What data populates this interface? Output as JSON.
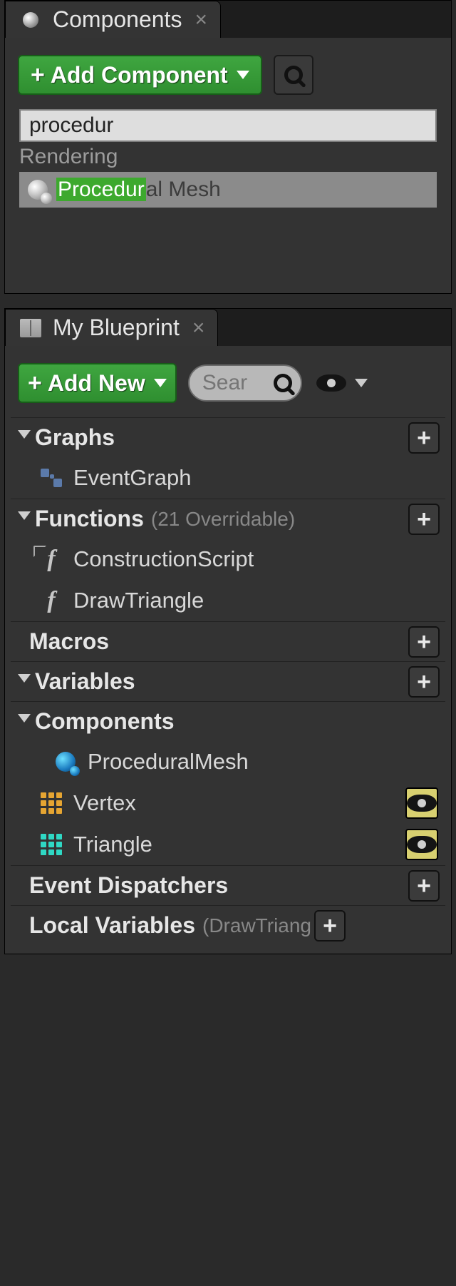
{
  "componentsPanel": {
    "tabTitle": "Components",
    "addBtn": "Add Component",
    "searchValue": "procedur",
    "categoryLabel": "Rendering",
    "result": {
      "highlight": "Procedur",
      "rest": "al Mesh"
    }
  },
  "blueprintPanel": {
    "tabTitle": "My Blueprint",
    "addBtn": "Add New",
    "searchPlaceholder": "Sear",
    "sections": {
      "graphs": {
        "label": "Graphs"
      },
      "functions": {
        "label": "Functions",
        "sub": "(21 Overridable)"
      },
      "macros": {
        "label": "Macros"
      },
      "variables": {
        "label": "Variables"
      },
      "components": {
        "label": "Components"
      },
      "eventDispatchers": {
        "label": "Event Dispatchers"
      },
      "localVariables": {
        "label": "Local Variables",
        "sub": "(DrawTriang"
      }
    },
    "items": {
      "eventGraph": "EventGraph",
      "constructionScript": "ConstructionScript",
      "drawTriangle": "DrawTriangle",
      "proceduralMesh": "ProceduralMesh",
      "vertex": "Vertex",
      "triangle": "Triangle"
    }
  }
}
